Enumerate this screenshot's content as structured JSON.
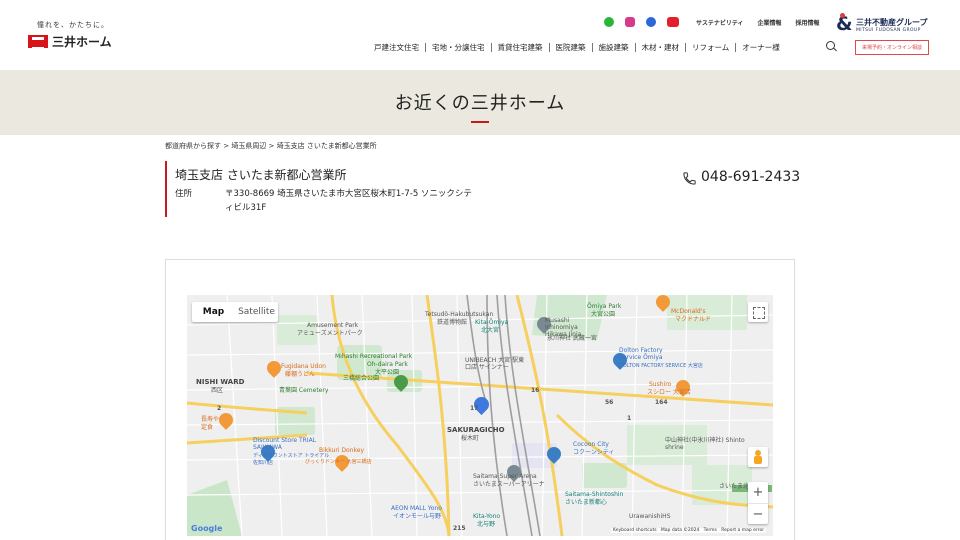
{
  "header": {
    "logo_tagline": "憧れを、かたちに。",
    "logo_name": "三井ホーム",
    "top_links": [
      "サステナビリティ",
      "企業情報",
      "採用情報"
    ],
    "social_icons": [
      "line-icon",
      "instagram-icon",
      "facebook-icon",
      "youtube-icon"
    ],
    "group_logo_jp": "三井不動産グループ",
    "group_logo_en": "MITSUI FUDOSAN GROUP",
    "nav": [
      "戸建注文住宅",
      "宅地・分譲住宅",
      "賃貸住宅建築",
      "医院建築",
      "施設建築",
      "木材・建材",
      "リフォーム",
      "オーナー様"
    ],
    "reserve_button": "来場予約・オンライン相談"
  },
  "hero": {
    "title": "お近くの三井ホーム"
  },
  "breadcrumb": "都道府県から探す > 埼玉県周辺 > 埼玉支店 さいたま新都心営業所",
  "branch": {
    "title": "埼玉支店 さいたま新都心営業所",
    "address_label": "住所",
    "address": "〒330-8669 埼玉県さいたま市大宮区桜木町1-7-5 ソニックシティビル31F",
    "phone": "048-691-2433"
  },
  "map": {
    "map_type": [
      "Map",
      "Satellite"
    ],
    "selected_map_type": "Map",
    "zoom_in": "+",
    "zoom_out": "−",
    "google_logo": "Google",
    "attribution": [
      "Keyboard shortcuts",
      "Map data ©2024",
      "Terms",
      "Report a map error"
    ],
    "labels": {
      "amusement_park": "Amusement Park",
      "amusement_park_jp": "アミューズメントパーク",
      "fugidana_udon": "Fugidana Udon",
      "fugidana_udon_jp": "藤棚うどん",
      "mihashi_rec": "Mihashi Recreational Park",
      "mihashi_rec_jp": "三橋総合公園",
      "ohdaira_park": "Oh-daira Park",
      "ohdaira_park_jp": "大平公園",
      "nishi_ward": "NISHI WARD",
      "nishi_ward_jp": "西区",
      "aoba_cemetery": "青葉園 Cemetery",
      "nagatoya": "長寿や",
      "teishoku": "定食",
      "discount_store": "Discount Store TRIAL SAJIKAWA",
      "discount_store_jp": "ディスカウントストア トライアル佐知川店",
      "bikkuri_donkey": "Bikkuri Donkey",
      "bikkuri_donkey_jp": "びっくりドンキー 大宮三橋店",
      "tetsudo_hakubutsukan": "Tetsudō-Hakubutsukan",
      "tetsudo_hakubutsukan_jp": "鉄道博物館",
      "kita_omiya": "Kita-Ōmiya",
      "kita_omiya_jp": "北大宮",
      "hikawa_jinja": "Musashi Ichinomiya Hikawa Jinja",
      "hikawa_jinja_jp": "氷川神社 武蔵一宮",
      "omiya_park": "Ōmiya Park",
      "omiya_park_jp": "大宮公園",
      "mcdonalds": "McDonald's",
      "mcdonalds_jp": "マクドナルド",
      "unibeach": "UNIBEACH 大宮 駅東口店 サインナー",
      "dolton_factory": "Dolton Factory Service Ōmiya",
      "dolton_factory_jp": "DOLTON FACTORY SERVICE 大宮店",
      "sushiro": "Sushiro",
      "sushiro_jp": "スシロー 大宮店",
      "sakuragicho": "SAKURAGICHO",
      "sakuragicho_jp": "桜木町",
      "nakayama_jinja": "中山神社(中氷川神社) Shinto shrine",
      "cocoon_city": "Cocoon City",
      "cocoon_city_jp": "コクーンシティ",
      "super_arena": "Saitama Super Arena",
      "super_arena_jp": "さいたまスーパーアリーナ",
      "shintoshin": "Saitama-Shintoshin",
      "shintoshin_jp": "さいたま新都心",
      "aeon_mall": "AEON MALL Yono",
      "aeon_mall_jp": "イオンモール与野",
      "kita_yono": "Kita-Yono",
      "kita_yono_jp": "北与野",
      "urawanishi": "UrawanishiHS",
      "saitama_kita_rd": "さいたま北",
      "route_17": "17",
      "route_16": "16",
      "route_164": "164",
      "route_2": "2",
      "route_56": "56",
      "route_1": "1",
      "route_215": "215"
    }
  }
}
